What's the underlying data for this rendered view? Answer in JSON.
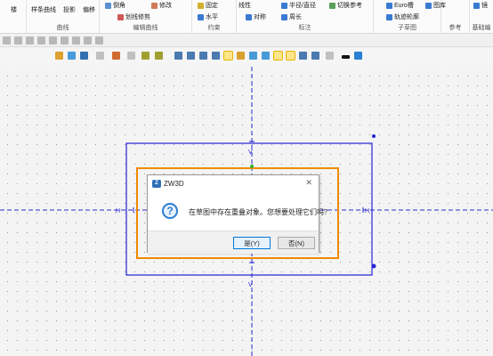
{
  "ribbon": {
    "groups": [
      {
        "label": "",
        "items": [
          "楼"
        ]
      },
      {
        "label": "曲线",
        "items": [
          "样条曲线",
          "投影",
          "偏移"
        ]
      },
      {
        "label": "编辑曲线",
        "items": [
          "倒角",
          "修改",
          "划线修剪"
        ]
      },
      {
        "label": "约束",
        "items": [
          "固定",
          "水平"
        ]
      },
      {
        "label": "标注",
        "items": [
          "线性",
          "对称",
          "半径/直径",
          "周长",
          "切换参考"
        ]
      },
      {
        "label": "子草图",
        "items": [
          "Euro槽",
          "轨迹轮廓",
          "图库"
        ]
      },
      {
        "label": "参考",
        "items": []
      },
      {
        "label": "基础编",
        "items": [
          "镜"
        ]
      }
    ]
  },
  "canvas": {
    "labels": [
      "H",
      "V",
      "H",
      "V"
    ]
  },
  "dialog": {
    "title": "ZW3D",
    "close_icon": "close-icon",
    "message": "在草图中存在重叠对象。您想要处理它们吗？",
    "yes_label": "是(Y)",
    "no_label": "否(N)",
    "accent": "#0078d7",
    "highlight": "#f08a00"
  },
  "colors": {
    "geometry": "#2323d6",
    "axis": "#2a2ad0",
    "midpoint": "#2fb02f"
  }
}
